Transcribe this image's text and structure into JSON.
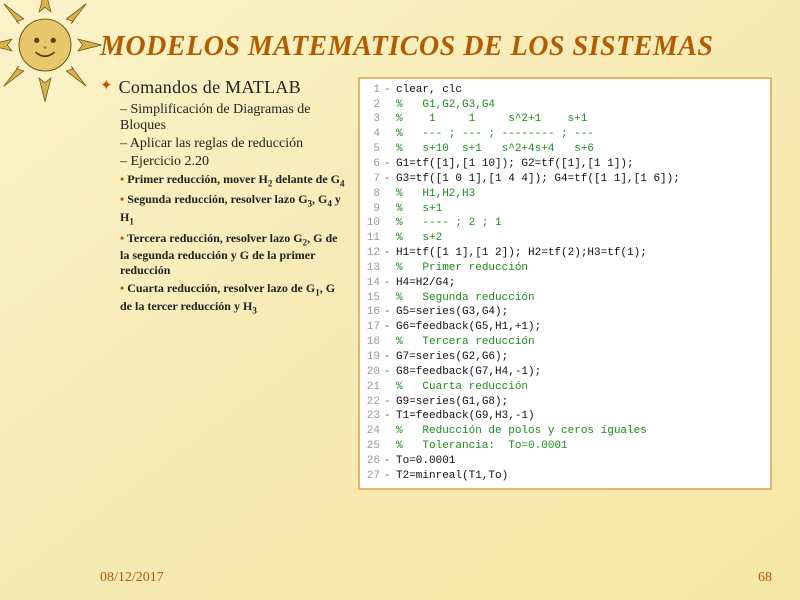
{
  "title": "MODELOS MATEMATICOS DE LOS SISTEMAS",
  "heading": "Comandos  de MATLAB",
  "subitems": [
    "Simplificación de Diagramas de Bloques",
    "Aplicar las reglas de reducción",
    "Ejercicio 2.20"
  ],
  "subsub": [
    {
      "pre": "Primer reducción, mover H",
      "s1": "2",
      "mid": " delante de G",
      "s2": "4",
      "post": ""
    },
    {
      "pre": "Segunda reducción, resolver lazo G",
      "s1": "3",
      "mid": ", G",
      "s2": "4",
      "post": " y H",
      "s3": "1"
    },
    {
      "pre": "Tercera reducción, resolver lazo G",
      "s1": "2",
      "mid": ", G de la segunda reducción y G de la primer reducción",
      "s2": "",
      "post": ""
    },
    {
      "pre": "Cuarta reducción, resolver lazo de G",
      "s1": "1",
      "mid": ", G de la tercer reducción y H",
      "s2": "3",
      "post": ""
    }
  ],
  "code": [
    {
      "n": 1,
      "d": "-",
      "t": "clear, clc",
      "c": "black"
    },
    {
      "n": 2,
      "d": "",
      "t": "%   G1,G2,G3,G4",
      "c": "green"
    },
    {
      "n": 3,
      "d": "",
      "t": "%    1     1     s^2+1    s+1",
      "c": "green"
    },
    {
      "n": 4,
      "d": "",
      "t": "%   --- ; --- ; -------- ; ---",
      "c": "green"
    },
    {
      "n": 5,
      "d": "",
      "t": "%   s+10  s+1   s^2+4s+4   s+6",
      "c": "green"
    },
    {
      "n": 6,
      "d": "-",
      "t": "G1=tf([1],[1 10]); G2=tf([1],[1 1]);",
      "c": "black"
    },
    {
      "n": 7,
      "d": "-",
      "t": "G3=tf([1 0 1],[1 4 4]); G4=tf([1 1],[1 6]);",
      "c": "black"
    },
    {
      "n": 8,
      "d": "",
      "t": "%   H1,H2,H3",
      "c": "green"
    },
    {
      "n": 9,
      "d": "",
      "t": "%   s+1",
      "c": "green"
    },
    {
      "n": 10,
      "d": "",
      "t": "%   ---- ; 2 ; 1",
      "c": "green"
    },
    {
      "n": 11,
      "d": "",
      "t": "%   s+2",
      "c": "green"
    },
    {
      "n": 12,
      "d": "-",
      "t": "H1=tf([1 1],[1 2]); H2=tf(2);H3=tf(1);",
      "c": "black"
    },
    {
      "n": 13,
      "d": "",
      "t": "%   Primer reducción",
      "c": "green"
    },
    {
      "n": 14,
      "d": "-",
      "t": "H4=H2/G4;",
      "c": "black"
    },
    {
      "n": 15,
      "d": "",
      "t": "%   Segunda reducción",
      "c": "green"
    },
    {
      "n": 16,
      "d": "-",
      "t": "G5=series(G3,G4);",
      "c": "black"
    },
    {
      "n": 17,
      "d": "-",
      "t": "G6=feedback(G5,H1,+1);",
      "c": "black"
    },
    {
      "n": 18,
      "d": "",
      "t": "%   Tercera reducción",
      "c": "green"
    },
    {
      "n": 19,
      "d": "-",
      "t": "G7=series(G2,G6);",
      "c": "black"
    },
    {
      "n": 20,
      "d": "-",
      "t": "G8=feedback(G7,H4,-1);",
      "c": "black"
    },
    {
      "n": 21,
      "d": "",
      "t": "%   Cuarta reducción",
      "c": "green"
    },
    {
      "n": 22,
      "d": "-",
      "t": "G9=series(G1,G8);",
      "c": "black"
    },
    {
      "n": 23,
      "d": "-",
      "t": "T1=feedback(G9,H3,-1)",
      "c": "black"
    },
    {
      "n": 24,
      "d": "",
      "t": "%   Reducción de polos y ceros iguales",
      "c": "green"
    },
    {
      "n": 25,
      "d": "",
      "t": "%   Tolerancia:  To=0.0001",
      "c": "green"
    },
    {
      "n": 26,
      "d": "-",
      "t": "To=0.0001",
      "c": "black"
    },
    {
      "n": 27,
      "d": "-",
      "t": "T2=minreal(T1,To)",
      "c": "black"
    }
  ],
  "footer": {
    "date": "08/12/2017",
    "page": "68"
  }
}
